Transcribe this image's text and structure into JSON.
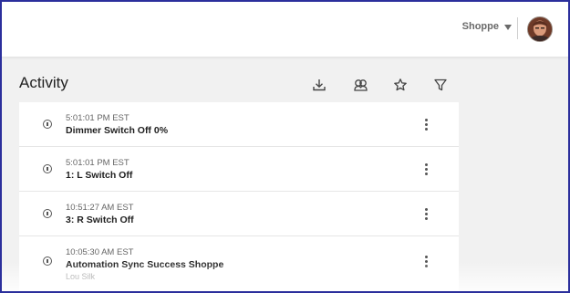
{
  "header": {
    "account_name": "Shoppe"
  },
  "page": {
    "title": "Activity"
  },
  "toolbar": {
    "icons": [
      "download-icon",
      "group-icon",
      "star-icon",
      "filter-icon"
    ]
  },
  "activity": {
    "items": [
      {
        "time": "5:01:01 PM EST",
        "title": "Dimmer Switch Off 0%",
        "sub": ""
      },
      {
        "time": "5:01:01 PM EST",
        "title": "1: L Switch Off",
        "sub": ""
      },
      {
        "time": "10:51:27 AM EST",
        "title": "3: R Switch Off",
        "sub": ""
      },
      {
        "time": "10:05:30 AM EST",
        "title": "Automation Sync Success Shoppe",
        "sub": "Lou Silk"
      }
    ]
  },
  "colors": {
    "frame_border": "#2b2f9c",
    "background": "#f1f1f1",
    "card": "#ffffff"
  }
}
